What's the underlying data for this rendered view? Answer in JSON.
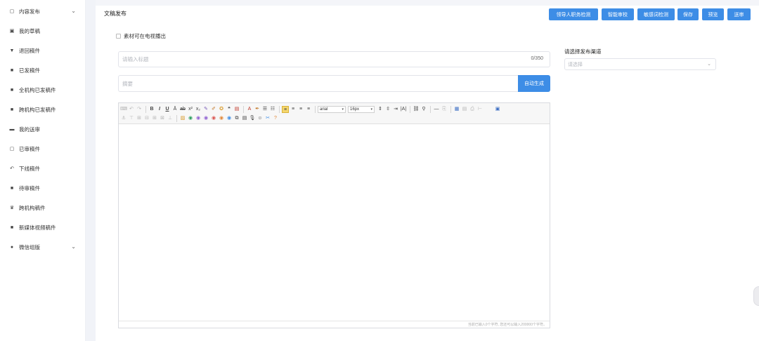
{
  "sidebar": {
    "items": [
      {
        "label": "内容发布",
        "icon": "document-icon",
        "glyph": "▢",
        "expandable": true
      },
      {
        "label": "我的草稿",
        "icon": "lock-icon",
        "glyph": "▣"
      },
      {
        "label": "退回稿件",
        "icon": "filter-icon",
        "glyph": "▼"
      },
      {
        "label": "已发稿件",
        "icon": "square-icon",
        "glyph": "■"
      },
      {
        "label": "全机构已发稿件",
        "icon": "square-icon",
        "glyph": "■"
      },
      {
        "label": "跨机构已发稿件",
        "icon": "square-icon",
        "glyph": "■"
      },
      {
        "label": "我的送审",
        "icon": "chat-icon",
        "glyph": "▬"
      },
      {
        "label": "已审稿件",
        "icon": "document-icon",
        "glyph": "▢"
      },
      {
        "label": "下线稿件",
        "icon": "undo-icon",
        "glyph": "↶"
      },
      {
        "label": "待审稿件",
        "icon": "pencil-icon",
        "glyph": "■"
      },
      {
        "label": "跨机构稿件",
        "icon": "crown-icon",
        "glyph": "♛"
      },
      {
        "label": "新媒体视频稿件",
        "icon": "video-icon",
        "glyph": "■"
      },
      {
        "label": "微信组版",
        "icon": "wechat-icon",
        "glyph": "●",
        "expandable": true
      }
    ]
  },
  "header": {
    "title": "文稿发布",
    "buttons": [
      "领导人职务检测",
      "智能审校",
      "敏感词检测",
      "保存",
      "预览",
      "送审"
    ]
  },
  "form": {
    "tv_checkbox_label": "素材可在电视播出",
    "title_placeholder": "请输入标题",
    "title_counter": "0/350",
    "abstract_placeholder": "摘要",
    "autogen_label": "自动生成",
    "channel_label": "请选择发布渠道",
    "channel_placeholder": "请选择"
  },
  "editor": {
    "font_family": "arial",
    "font_size": "16px",
    "status_text": "当前已输入0个字符, 您还可以输入200000个字符。"
  },
  "colors": {
    "primary": "#3d8de6",
    "sidebar_bg": "#ffffff",
    "gap_bg": "#f1f3f8"
  }
}
